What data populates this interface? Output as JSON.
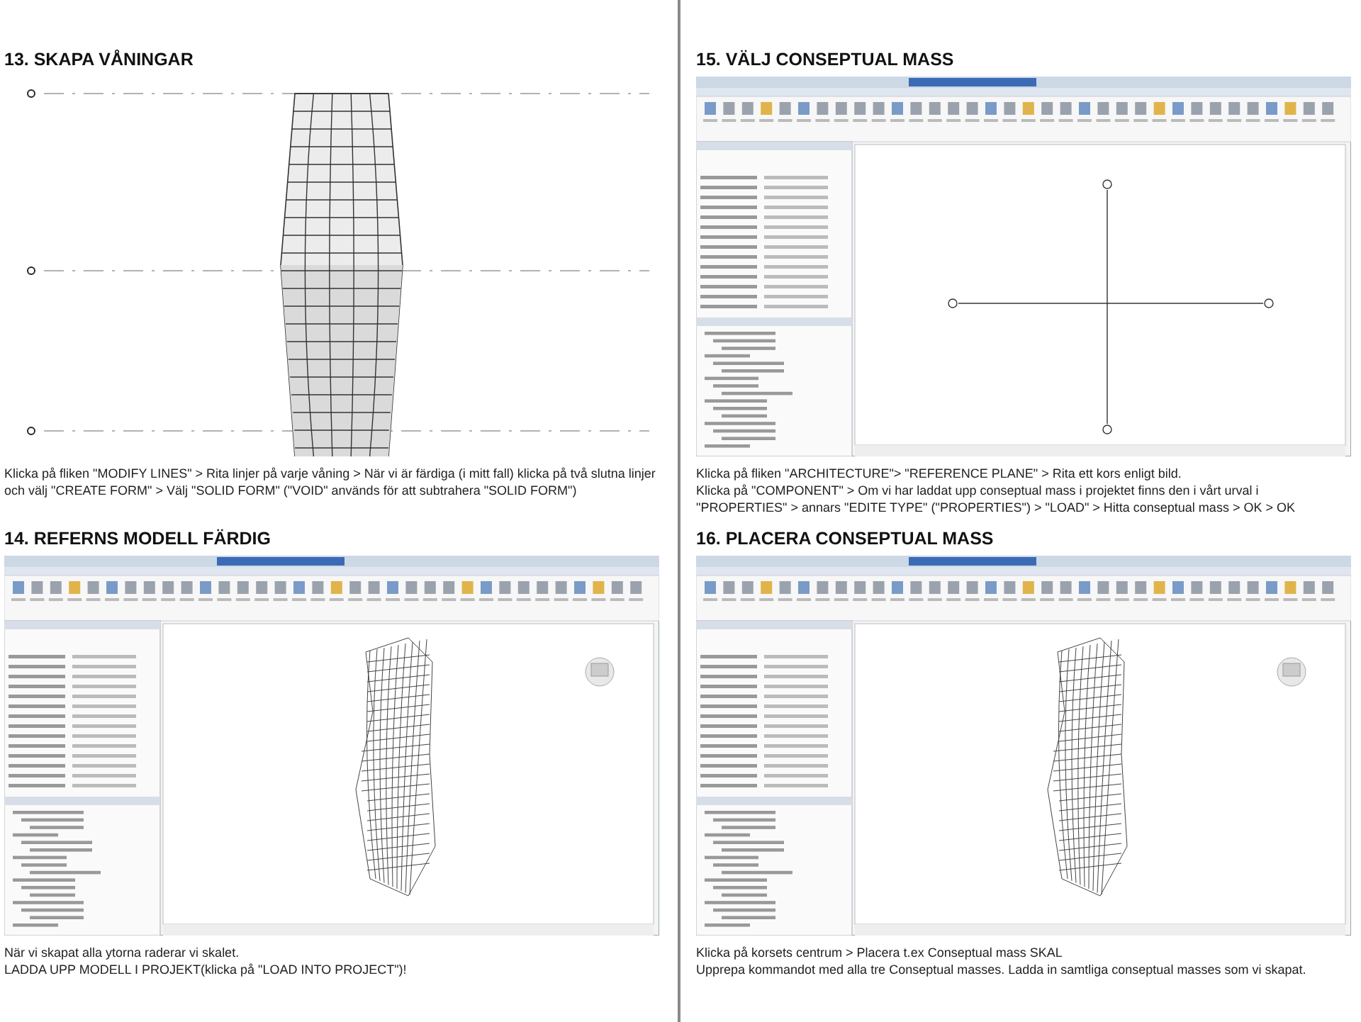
{
  "columns": [
    {
      "sections": [
        {
          "heading": "13. SKAPA VÅNINGAR",
          "figure": {
            "kind": "elevation"
          },
          "caption": [
            "Klicka på fliken \"MODIFY LINES\" > Rita linjer på varje våning > När vi är färdiga (i mitt fall) klicka på två slutna linjer och välj \"CREATE FORM\" > Välj \"SOLID FORM\" (\"VOID\" används för att subtrahera \"SOLID FORM\")"
          ]
        },
        {
          "heading": "14. REFERNS MODELL FÄRDIG",
          "figure": {
            "kind": "app-3d"
          },
          "caption": [
            "När vi skapat alla ytorna raderar vi skalet.",
            "LADDA UPP MODELL I PROJEKT(klicka på \"LOAD INTO PROJECT\")!"
          ]
        }
      ]
    },
    {
      "sections": [
        {
          "heading": "15. VÄLJ CONSEPTUAL MASS",
          "figure": {
            "kind": "app-plan"
          },
          "caption": [
            "Klicka på fliken \"ARCHITECTURE\"> \"REFERENCE PLANE\" > Rita ett kors enligt bild.",
            "Klicka på \"COMPONENT\" > Om vi har laddat upp conseptual mass i projektet finns den i vårt urval i \"PROPERTIES\" > annars \"EDITE TYPE\" (\"PROPERTIES\") > \"LOAD\" > Hitta conseptual mass > OK > OK"
          ]
        },
        {
          "heading": "16. PLACERA CONSEPTUAL MASS",
          "figure": {
            "kind": "app-3d"
          },
          "caption": [
            "Klicka på korsets centrum > Placera t.ex Conseptual mass SKAL",
            "Upprepa kommandot med alla tre Conseptual masses. Ladda in samtliga conseptual masses som vi skapat."
          ]
        }
      ]
    }
  ]
}
